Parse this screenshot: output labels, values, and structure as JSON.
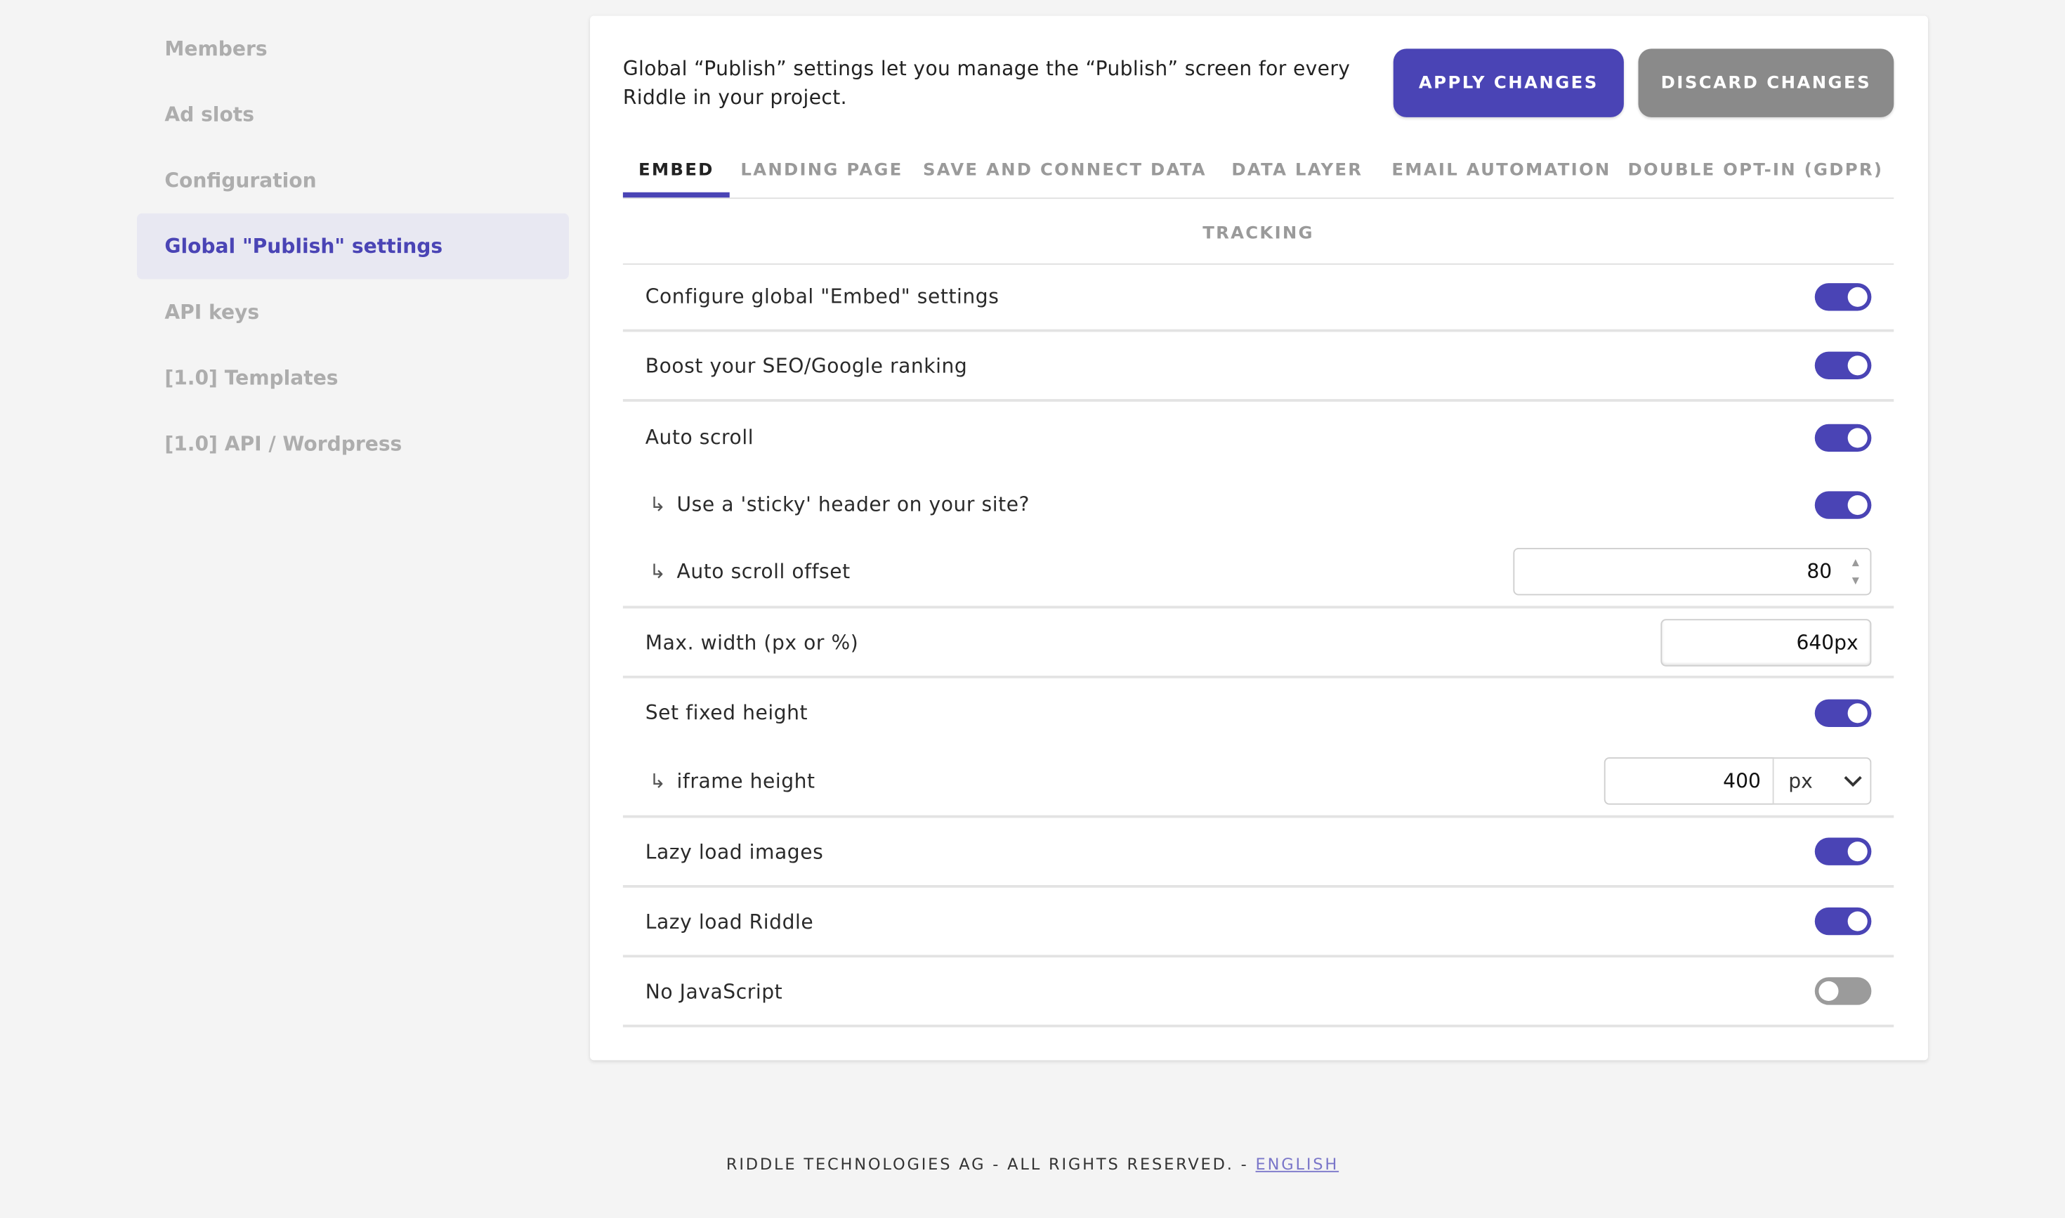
{
  "sidebar": {
    "items": [
      {
        "label": "Members"
      },
      {
        "label": "Ad slots"
      },
      {
        "label": "Configuration"
      },
      {
        "label": "Global \"Publish\" settings",
        "active": true
      },
      {
        "label": "API keys"
      },
      {
        "label": "[1.0] Templates"
      },
      {
        "label": "[1.0] API / Wordpress"
      }
    ]
  },
  "header": {
    "intro": "Global “Publish” settings let you manage the “Publish” screen for every Riddle in your project.",
    "apply_label": "APPLY CHANGES",
    "discard_label": "DISCARD CHANGES"
  },
  "tabs": [
    {
      "label": "EMBED",
      "active": true
    },
    {
      "label": "LANDING PAGE"
    },
    {
      "label": "SAVE AND CONNECT DATA"
    },
    {
      "label": "DATA LAYER"
    },
    {
      "label": "EMAIL AUTOMATION"
    },
    {
      "label": "DOUBLE OPT-IN (GDPR)"
    },
    {
      "label": "TRACKING"
    }
  ],
  "settings": {
    "configure_embed": {
      "label": "Configure global \"Embed\" settings",
      "enabled": true
    },
    "boost_seo": {
      "label": "Boost your SEO/Google ranking",
      "enabled": true
    },
    "auto_scroll": {
      "label": "Auto scroll",
      "enabled": true
    },
    "sticky_header": {
      "label": "Use a 'sticky' header on your site?",
      "enabled": true
    },
    "auto_scroll_offset": {
      "label": "Auto scroll offset",
      "value": "80"
    },
    "max_width": {
      "label": "Max. width (px or %)",
      "value": "640px"
    },
    "fixed_height": {
      "label": "Set fixed height",
      "enabled": true
    },
    "iframe_height": {
      "label": "iframe height",
      "value": "400",
      "unit": "px"
    },
    "lazy_images": {
      "label": "Lazy load images",
      "enabled": true
    },
    "lazy_riddle": {
      "label": "Lazy load Riddle",
      "enabled": true
    },
    "no_javascript": {
      "label": "No JavaScript",
      "enabled": false
    }
  },
  "icons": {
    "sub_arrow": "↳",
    "spinner_up": "▲",
    "spinner_down": "▼",
    "chevron_down": "chevron-down-icon"
  },
  "colors": {
    "accent": "#4a44b5",
    "discard": "#8a8a8a",
    "toggle_off": "#9b9b9b",
    "active_sidebar_bg": "#e8e8f2",
    "link": "#7a76c9"
  },
  "footer": {
    "text": "RIDDLE TECHNOLOGIES AG - ALL RIGHTS RESERVED. - ",
    "language_label": "ENGLISH"
  }
}
